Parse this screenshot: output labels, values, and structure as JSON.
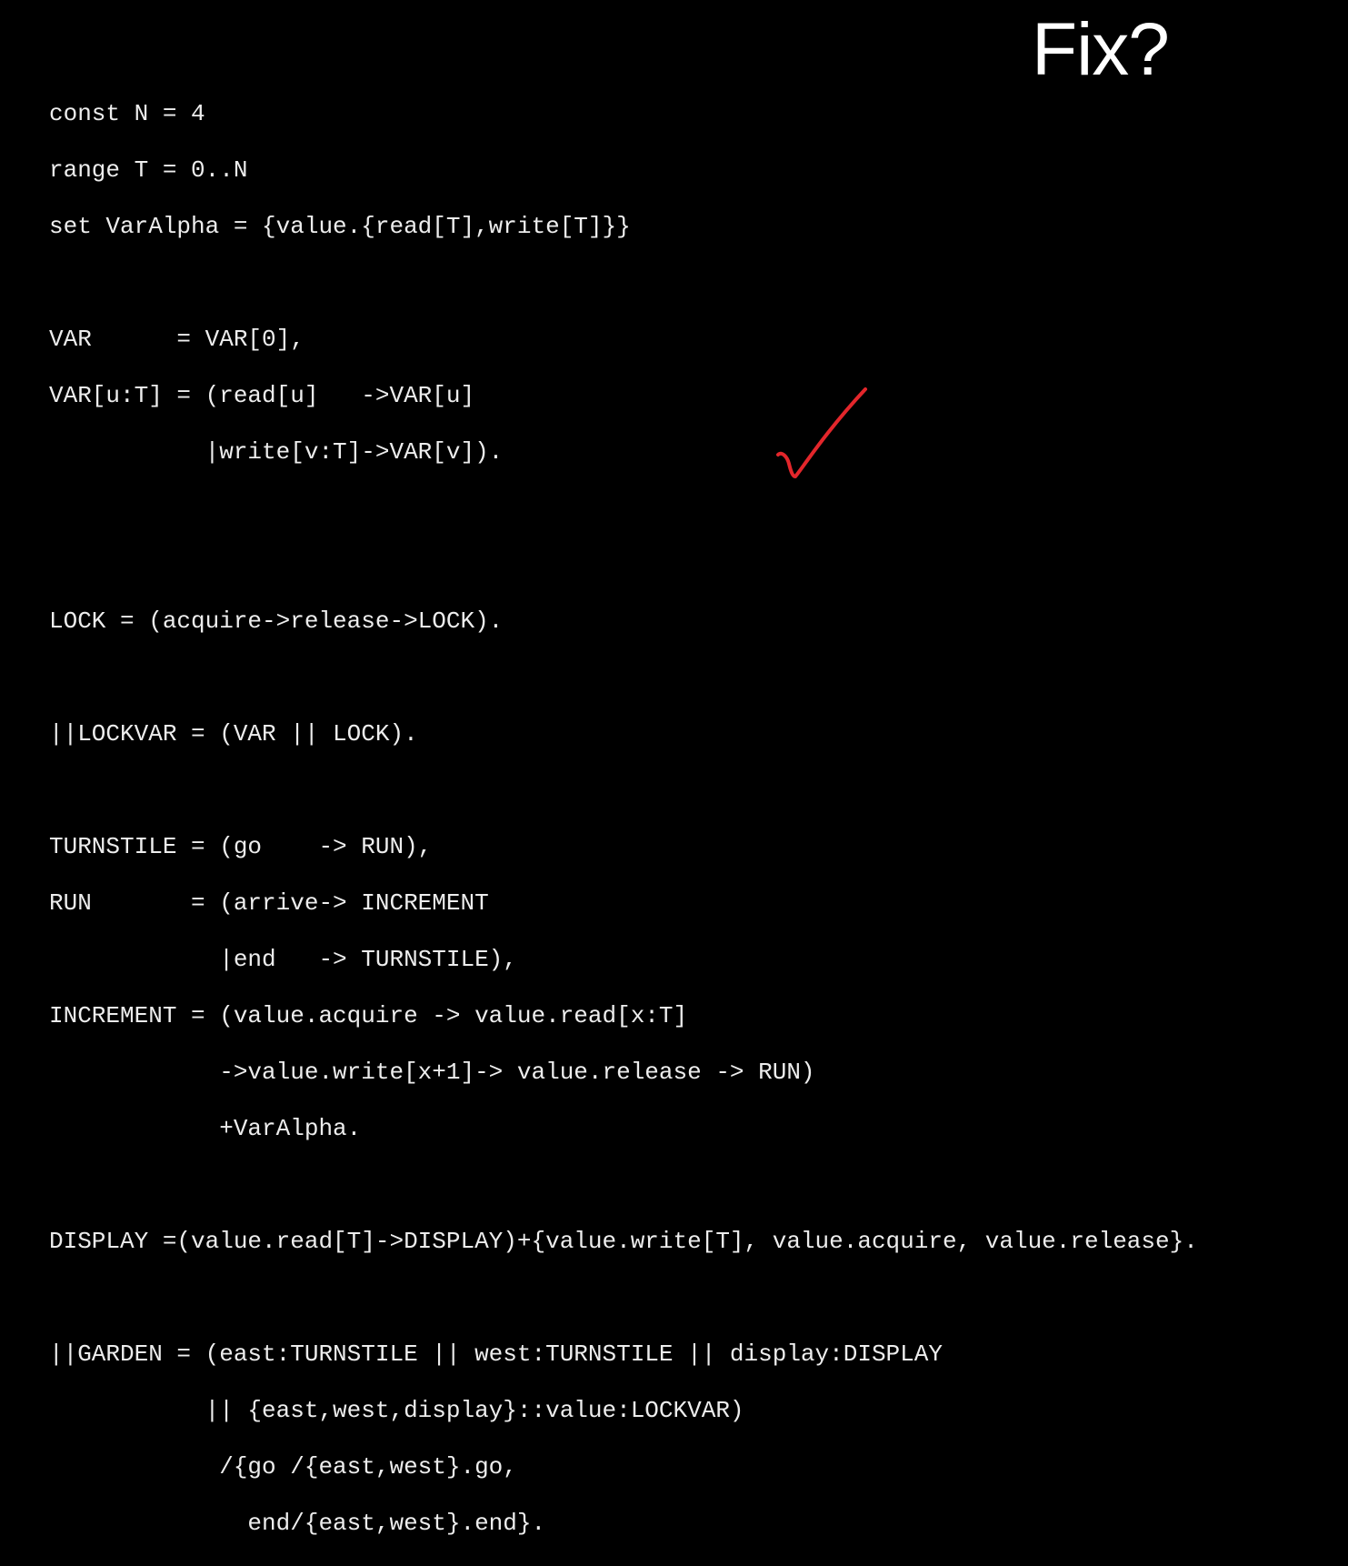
{
  "slide": {
    "title": "Fix?"
  },
  "code": {
    "lines": [
      "const N = 4",
      "range T = 0..N",
      "set VarAlpha = {value.{read[T],write[T]}}",
      "",
      "VAR      = VAR[0],",
      "VAR[u:T] = (read[u]   ->VAR[u]",
      "           |write[v:T]->VAR[v]).",
      "",
      "",
      "LOCK = (acquire->release->LOCK).",
      "",
      "||LOCKVAR = (VAR || LOCK).",
      "",
      "TURNSTILE = (go    -> RUN),",
      "RUN       = (arrive-> INCREMENT",
      "            |end   -> TURNSTILE),",
      "INCREMENT = (value.acquire -> value.read[x:T]",
      "            ->value.write[x+1]-> value.release -> RUN)",
      "            +VarAlpha.",
      "",
      "DISPLAY =(value.read[T]->DISPLAY)+{value.write[T], value.acquire, value.release}.",
      "",
      "||GARDEN = (east:TURNSTILE || west:TURNSTILE || display:DISPLAY",
      "           || {east,west,display}::value:LOCKVAR)",
      "            /{go /{east,west}.go,",
      "              end/{east,west}.end}."
    ]
  },
  "annotation": {
    "icon": "checkmark-icon",
    "color": "#e3262b"
  }
}
